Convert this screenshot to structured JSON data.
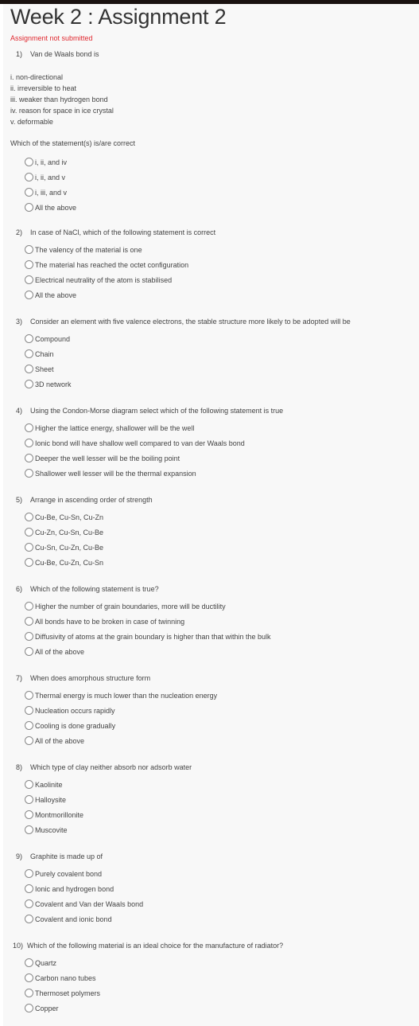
{
  "header": {
    "title": "Week 2 : Assignment 2",
    "status": "Assignment not submitted",
    "status_color": "#e0282f"
  },
  "questions": [
    {
      "number": "1)",
      "text": "Van de Waals bond is",
      "statements": [
        "i. non-directional",
        "ii. irreversible to heat",
        "iii. weaker than hydrogen bond",
        "iv. reason for space in ice crystal",
        "v. deformable"
      ],
      "prompt": "Which of the statement(s) is/are correct",
      "options": [
        "i, ii, and iv",
        "i, ii, and v",
        "i, iii, and v",
        "All the above"
      ]
    },
    {
      "number": "2)",
      "text": "In case of NaCl, which of the following statement is correct",
      "options": [
        "The valency of the material is one",
        "The material has reached the octet configuration",
        "Electrical neutrality of the atom is stabilised",
        "All the above"
      ]
    },
    {
      "number": "3)",
      "text": "Consider an element with five valence electrons, the stable structure more likely to be adopted will be",
      "options": [
        "Compound",
        "Chain",
        "Sheet",
        "3D network"
      ]
    },
    {
      "number": "4)",
      "text": "Using the Condon-Morse diagram select which of the following statement is true",
      "options": [
        "Higher the lattice energy, shallower will be the well",
        "Ionic bond will have shallow well compared to van der Waals bond",
        "Deeper the well lesser will be the boiling point",
        "Shallower well lesser will be the thermal expansion"
      ]
    },
    {
      "number": "5)",
      "text": "Arrange in ascending order of strength",
      "options": [
        "Cu-Be, Cu-Sn, Cu-Zn",
        "Cu-Zn, Cu-Sn, Cu-Be",
        "Cu-Sn, Cu-Zn, Cu-Be",
        "Cu-Be, Cu-Zn, Cu-Sn"
      ]
    },
    {
      "number": "6)",
      "text": "Which of the following statement is true?",
      "options": [
        "Higher the number of grain boundaries, more will be ductility",
        "All bonds have to be broken in case of twinning",
        "Diffusivity of atoms at the grain boundary is higher than that within the bulk",
        "All of the above"
      ]
    },
    {
      "number": "7)",
      "text": "When does amorphous structure form",
      "options": [
        "Thermal energy is much lower than the nucleation energy",
        "Nucleation occurs rapidly",
        "Cooling is done gradually",
        "All of the above"
      ]
    },
    {
      "number": "8)",
      "text": "Which type of clay neither absorb nor adsorb water",
      "options": [
        "Kaolinite",
        "Halloysite",
        "Montmorillonite",
        "Muscovite"
      ]
    },
    {
      "number": "9)",
      "text": "Graphite is made up of",
      "options": [
        "Purely covalent bond",
        "Ionic and hydrogen bond",
        "Covalent and Van der Waals bond",
        "Covalent and ionic bond"
      ]
    },
    {
      "number": "10)",
      "text": "Which of the following material is an ideal choice for the manufacture of radiator?",
      "options": [
        "Quartz",
        "Carbon nano tubes",
        "Thermoset polymers",
        "Copper"
      ]
    }
  ]
}
